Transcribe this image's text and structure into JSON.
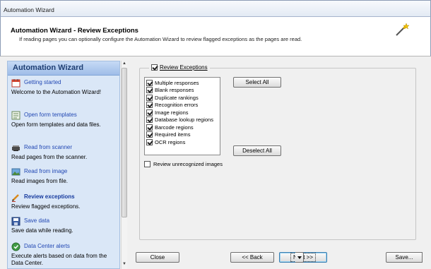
{
  "window": {
    "title": "Automation Wizard"
  },
  "header": {
    "title": "Automation Wizard - Review Exceptions",
    "description": "If reading pages you can optionally configure the Automation Wizard to review flagged exceptions as the pages are read."
  },
  "sidebar": {
    "heading": "Automation Wizard",
    "items": [
      {
        "label": "Getting started",
        "description": "Welcome to the Automation Wizard!",
        "icon": "getting-started-icon"
      },
      {
        "label": "Open form templates",
        "description": "Open form templates and data files.",
        "icon": "form-template-icon"
      },
      {
        "label": "Read from scanner",
        "description": "Read pages from the scanner.",
        "icon": "scanner-icon"
      },
      {
        "label": "Read from image",
        "description": "Read images from file.",
        "icon": "image-icon"
      },
      {
        "label": "Review exceptions",
        "description": "Review flagged exceptions.",
        "icon": "pencil-icon",
        "active": true
      },
      {
        "label": "Save data",
        "description": "Save data while reading.",
        "icon": "save-icon"
      },
      {
        "label": "Data Center alerts",
        "description": "Execute alerts based on data from the Data Center.",
        "icon": "check-circle-icon"
      }
    ]
  },
  "review": {
    "group_label": "Review Exceptions",
    "group_checked": true,
    "exceptions": [
      {
        "label": "Multiple responses",
        "checked": true
      },
      {
        "label": "Blank responses",
        "checked": true
      },
      {
        "label": "Duplicate rankings",
        "checked": true
      },
      {
        "label": "Recognition errors",
        "checked": true
      },
      {
        "label": "Image regions",
        "checked": true
      },
      {
        "label": "Database lookup regions",
        "checked": true
      },
      {
        "label": "Barcode regions",
        "checked": true
      },
      {
        "label": "Required items",
        "checked": true
      },
      {
        "label": "OCR regions",
        "checked": true
      }
    ],
    "select_all": "Select All",
    "deselect_all": "Deselect All",
    "unrecognized_label": "Review unrecognized images",
    "unrecognized_checked": false
  },
  "footer": {
    "close": "Close",
    "back": "<< Back",
    "next": "Next >>",
    "save": "Save..."
  },
  "colors": {
    "accent": "#2147b3",
    "sidebar_bg": "#dae7f7",
    "sidebar_heading": "#1f3f73"
  }
}
